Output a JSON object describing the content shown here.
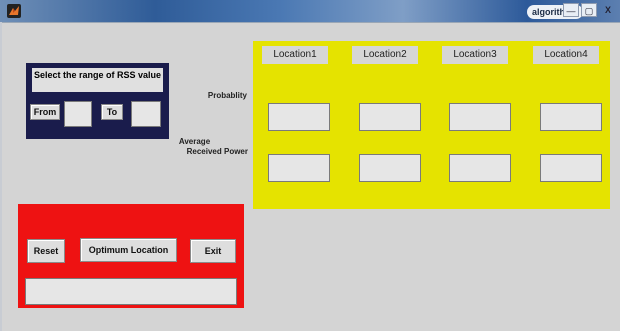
{
  "window": {
    "title": "algorithem",
    "minimize_glyph": "—",
    "restore_glyph": "▢",
    "close_glyph": "X"
  },
  "range_panel": {
    "title": "Select the range of RSS value",
    "from_label": "From",
    "to_label": "To",
    "from_value": "",
    "to_value": ""
  },
  "locations": [
    "Location1",
    "Location2",
    "Location3",
    "Location4"
  ],
  "rows": {
    "probability_label": "Probablity",
    "avg_power_label_line1": "Average",
    "avg_power_label_line2": "Received Power"
  },
  "actions": {
    "reset_label": "Reset",
    "optimum_label": "Optimum Location",
    "exit_label": "Exit",
    "result_value": ""
  },
  "colors": {
    "range_panel": "#1a1c4c",
    "location_panel": "#e5e300",
    "action_panel": "#ee1212",
    "background": "#d4d4d4"
  }
}
